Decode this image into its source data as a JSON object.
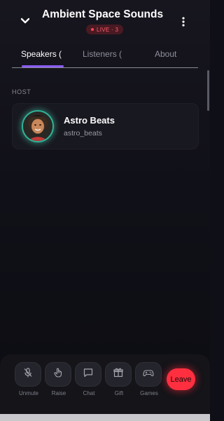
{
  "header": {
    "title": "Ambient Space Sounds",
    "live_badge": "LIVE · 3",
    "back_icon": "chevron-down-icon",
    "menu_icon": "more-vertical-icon"
  },
  "tabs": [
    {
      "label": "Speakers (",
      "active": true
    },
    {
      "label": "Listeners (",
      "active": false
    },
    {
      "label": "About",
      "active": false
    }
  ],
  "section": {
    "label": "HOST"
  },
  "host": {
    "name": "Astro Beats",
    "handle": "astro_beats"
  },
  "controls": [
    {
      "label": "Unmute",
      "icon": "mic-off-icon"
    },
    {
      "label": "Raise",
      "icon": "hand-icon"
    },
    {
      "label": "Chat",
      "icon": "chat-icon"
    },
    {
      "label": "Gift",
      "icon": "gift-icon"
    },
    {
      "label": "Games",
      "icon": "gamepad-icon"
    }
  ],
  "leave": {
    "label": "Leave"
  },
  "colors": {
    "accent": "#8b5cf6",
    "live": "#ff4456",
    "leave": "#ff2f3f",
    "avatar_ring": "#2fb39a"
  }
}
